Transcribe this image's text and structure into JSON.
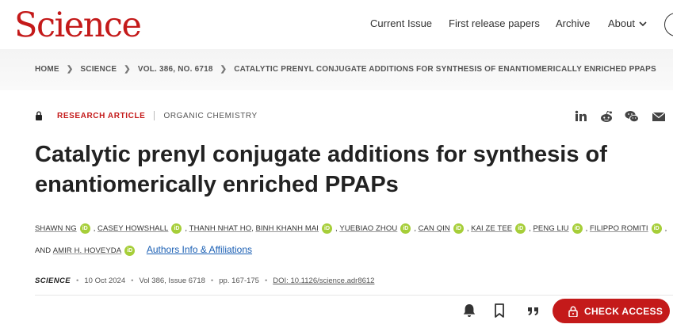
{
  "header": {
    "logo": "Science",
    "nav": [
      "Current Issue",
      "First release papers",
      "Archive",
      "About"
    ]
  },
  "breadcrumb": [
    "HOME",
    "SCIENCE",
    "VOL. 386, NO. 6718",
    "CATALYTIC PRENYL CONJUGATE ADDITIONS FOR SYNTHESIS OF ENANTIOMERICALLY ENRICHED PPAPS"
  ],
  "article": {
    "type": "RESEARCH ARTICLE",
    "subject": "ORGANIC CHEMISTRY",
    "title": "Catalytic prenyl conjugate additions for synthesis of enantiomerically enriched PPAPs",
    "authors": [
      "SHAWN NG",
      "CASEY HOWSHALL",
      "THANH NHAT HO",
      "BINH KHANH MAI",
      "YUEBIAO ZHOU",
      "CAN QIN",
      "KAI ZE TEE",
      "PENG LIU",
      "FILIPPO ROMITI",
      "AMIR H. HOVEYDA"
    ],
    "and_label": "AND",
    "affiliations_link": "Authors Info & Affiliations",
    "orcid_label": "iD"
  },
  "citation": {
    "journal": "SCIENCE",
    "date": "10 Oct 2024",
    "volume": "Vol 386, Issue 6718",
    "pages": "pp. 167-175",
    "doi": "DOI: 10.1126/science.adr8612"
  },
  "actions": {
    "check_access": "CHECK ACCESS"
  },
  "icons": {
    "share": [
      "linkedin-icon",
      "reddit-icon",
      "wechat-icon",
      "email-icon"
    ],
    "bottom": [
      "bell-icon",
      "bookmark-icon",
      "quote-icon"
    ]
  },
  "colors": {
    "brand_red": "#c41a1a",
    "orcid_green": "#a6ce39",
    "link_blue": "#1a5fb4"
  }
}
